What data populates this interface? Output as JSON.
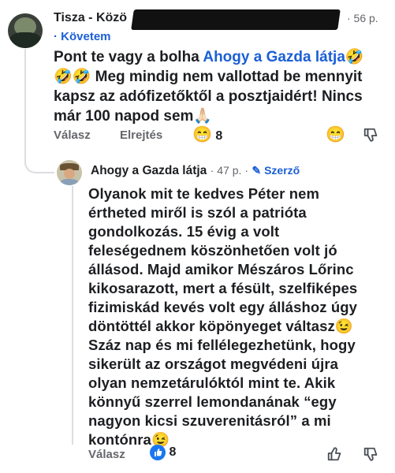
{
  "comment1": {
    "author_visible": "Tisza - Közö",
    "time": "· 56 p.",
    "follow": "· Követem",
    "mention": "Ahogy a Gazda látja",
    "line1_prefix": "Pont te vagy a bolha ",
    "line2": "Meg mindig nem vallottad be mennyit",
    "line3": "kapsz az adófizetőktől a posztjaidért! Nincs",
    "line4": "már 100 napod sem",
    "actions": {
      "reply": "Válasz",
      "hide": "Elrejtés"
    },
    "reaction_count": "8"
  },
  "comment2": {
    "author": "Ahogy a Gazda látja",
    "time": "· 47 p. ·",
    "badge": "Szerző",
    "lines": [
      "Olyanok mit te kedves Péter nem",
      "értheted miről is szól a patrióta",
      "gondolkozás. 15 évig a volt",
      "feleségednem köszönhetően volt jó",
      "állásod. Majd amikor Mészáros Lőrinc",
      "kikosarazott, mert a fésült, szelfiképes",
      "fizimiskád kevés volt egy álláshoz úgy",
      "döntöttél akkor köpönyeget váltasz",
      "Száz nap és mi fellélegezhetünk, hogy",
      "sikerült az országot megvédeni újra",
      "olyan nemzetárulóktól mint te. Akik",
      "könnyű szerrel lemondanának “egy",
      "nagyon kicsi szuverenitásról” a mi",
      "kontónra"
    ],
    "actions": {
      "reply": "Válasz"
    },
    "reaction_count": "8"
  },
  "emoji": {
    "rofl": "🤣",
    "hands": "🙏🏻",
    "grin": "😁",
    "wink": "😉",
    "pencil": "✎"
  },
  "colors": {
    "link": "#1b5fd6",
    "secondary": "#65676b",
    "like": "#1877f2"
  }
}
